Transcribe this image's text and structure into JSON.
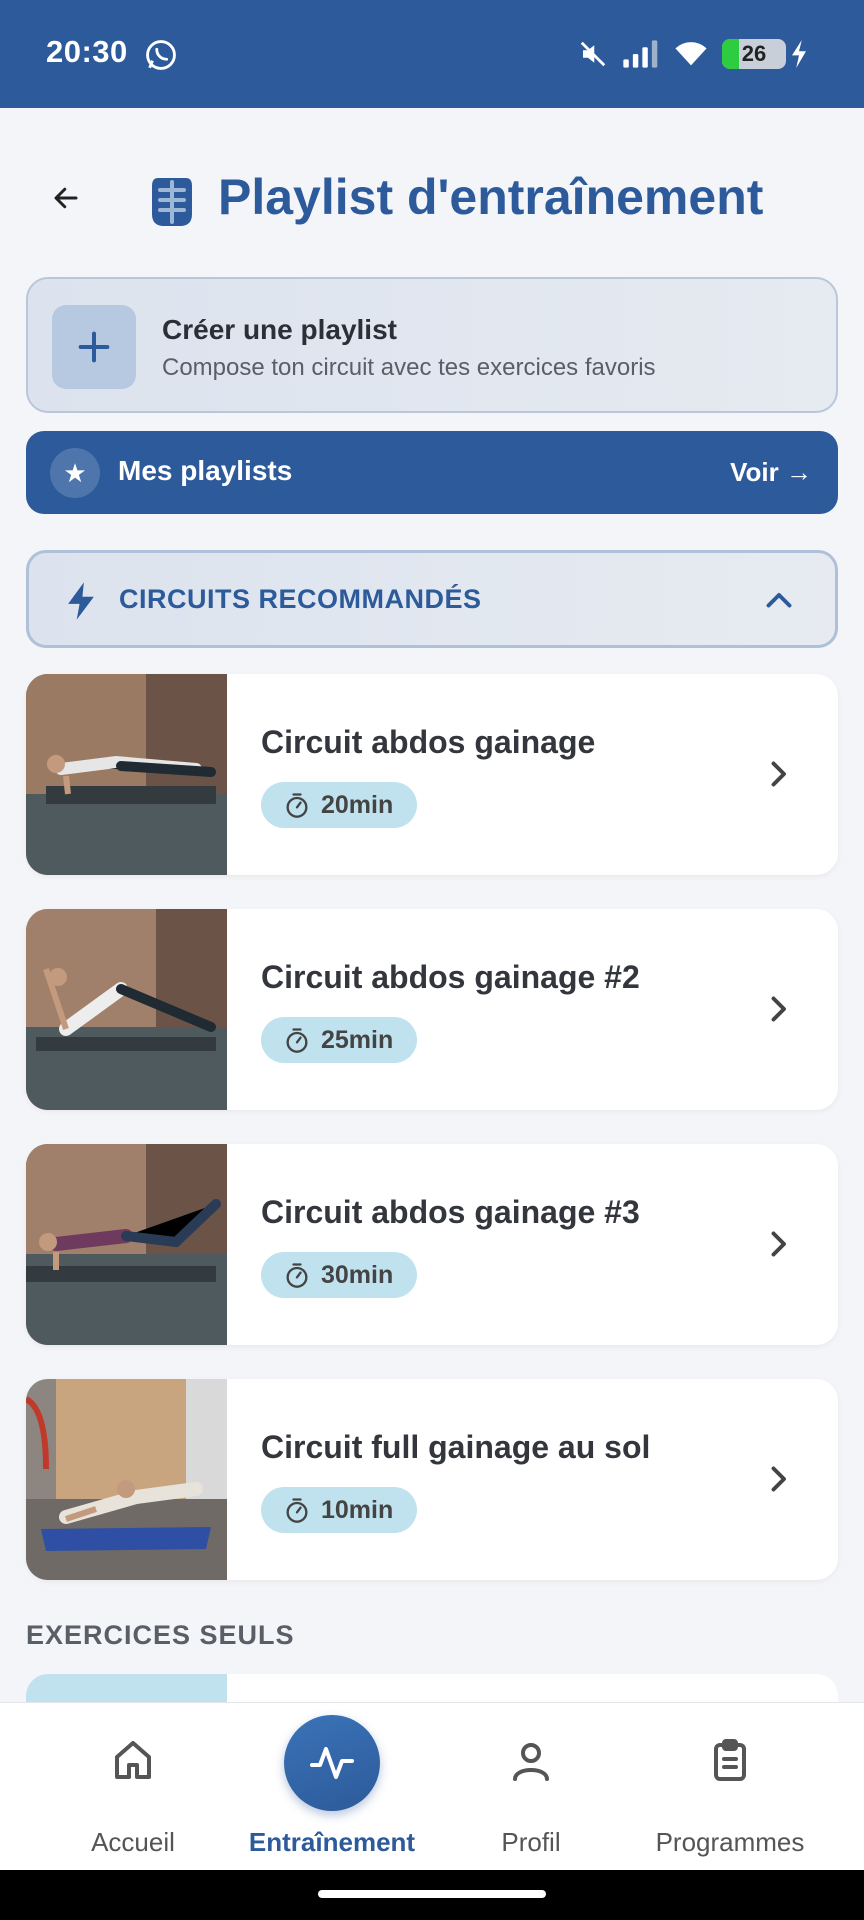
{
  "status_bar": {
    "time": "20:30",
    "battery": "26",
    "battery_level": 0.26,
    "icons": [
      "whatsapp-icon",
      "mute-icon",
      "signal-icon",
      "wifi-icon",
      "battery-icon",
      "charging-icon"
    ]
  },
  "header": {
    "title": "Playlist d'entraînement",
    "back_icon": "arrow-left-icon",
    "title_icon": "guard-icon"
  },
  "create_playlist": {
    "title": "Créer une playlist",
    "subtitle": "Compose ton circuit avec tes exercices favoris"
  },
  "my_playlists": {
    "label": "Mes playlists",
    "action": "Voir →"
  },
  "recommended": {
    "label": "CIRCUITS RECOMMANDÉS",
    "circuits": [
      {
        "title": "Circuit abdos gainage",
        "duration": "20min"
      },
      {
        "title": "Circuit abdos gainage #2",
        "duration": "25min"
      },
      {
        "title": "Circuit abdos gainage #3",
        "duration": "30min"
      },
      {
        "title": "Circuit full gainage au sol",
        "duration": "10min"
      }
    ]
  },
  "single_exercises": {
    "label": "EXERCICES SEULS"
  },
  "bottom_nav": {
    "items": [
      {
        "label": "Accueil",
        "icon": "home-icon"
      },
      {
        "label": "Entraînement",
        "icon": "activity-icon",
        "active": true
      },
      {
        "label": "Profil",
        "icon": "user-icon"
      },
      {
        "label": "Programmes",
        "icon": "clipboard-icon"
      }
    ]
  },
  "colors": {
    "primary": "#2D5A9A",
    "badge": "#BFE2EE",
    "background": "#F4F5F8"
  }
}
